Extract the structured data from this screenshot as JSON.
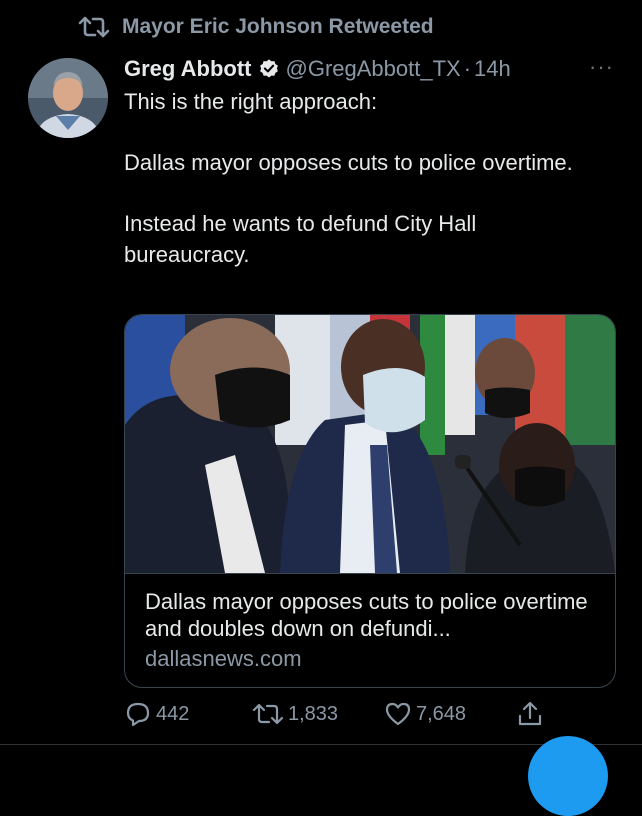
{
  "retweet": {
    "icon": "retweet-icon",
    "text": "Mayor Eric Johnson Retweeted"
  },
  "tweet": {
    "author_name": "Greg Abbott",
    "verified_icon": "verified-badge-icon",
    "handle": "@GregAbbott_TX",
    "separator": "·",
    "time": "14h",
    "more_icon": "more-options-icon",
    "more_glyph": "···",
    "text_lines": [
      "This is the right approach:",
      "Dallas mayor opposes cuts to police overtime.",
      "Instead he wants to defund City Hall bureaucracy."
    ]
  },
  "card": {
    "title": "Dallas mayor opposes cuts to police overtime and doubles down on defundi...",
    "domain": "dallasnews.com"
  },
  "actions": {
    "reply_count": "442",
    "retweet_count": "1,833",
    "like_count": "7,648",
    "share_icon": "share-icon"
  },
  "colors": {
    "background": "#000000",
    "text": "#e7e9ea",
    "secondary": "#8b98a5",
    "verified": "#e7e9ea",
    "accent": "#1d9bf0",
    "border": "#38444d"
  }
}
